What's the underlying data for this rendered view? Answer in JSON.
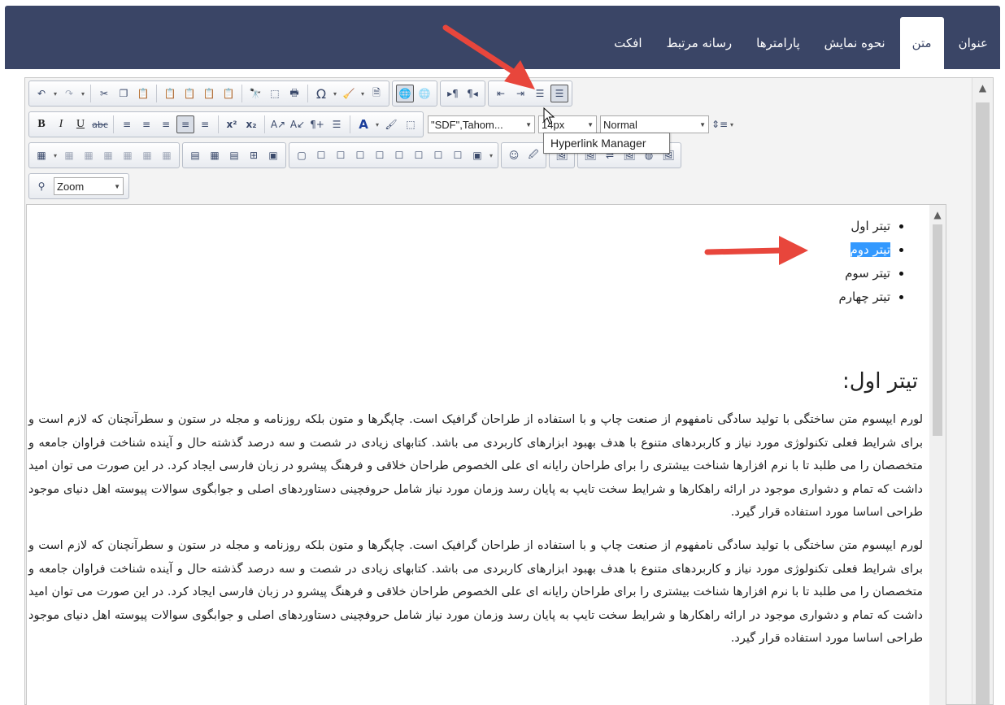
{
  "tabs": [
    {
      "label": "عنوان",
      "active": false
    },
    {
      "label": "متن",
      "active": true
    },
    {
      "label": "نحوه نمایش",
      "active": false
    },
    {
      "label": "پارامترها",
      "active": false
    },
    {
      "label": "رسانه مرتبط",
      "active": false
    },
    {
      "label": "افکت",
      "active": false
    }
  ],
  "toolbar": {
    "font_name": "\"SDF\",Tahom...",
    "font_size": "14px",
    "paragraph_style": "Normal",
    "zoom": "Zoom"
  },
  "tooltip": "Hyperlink Manager",
  "content": {
    "list_items": [
      "تیتر اول",
      "تیتر دوم",
      "تیتر سوم",
      "تیتر چهارم"
    ],
    "selected_item_index": 1,
    "heading": "تیتر اول:",
    "paragraphs": [
      "لورم ایپسوم متن ساختگی با تولید سادگی نامفهوم از صنعت چاپ و با استفاده از طراحان گرافیک است. چاپگرها و متون بلکه روزنامه و مجله در ستون و سطرآنچنان که لازم است و برای شرایط فعلی تکنولوژی مورد نیاز و کاربردهای متنوع با هدف بهبود ابزارهای کاربردی می باشد. کتابهای زیادی در شصت و سه درصد گذشته حال و آینده شناخت فراوان جامعه و متخصصان را می طلبد تا با نرم افزارها شناخت بیشتری را برای طراحان رایانه ای علی الخصوص طراحان خلاقی و فرهنگ پیشرو در زبان فارسی ایجاد کرد. در این صورت می توان امید داشت که تمام و دشواری موجود در ارائه راهکارها و شرایط سخت تایپ به پایان رسد وزمان مورد نیاز شامل حروفچینی دستاوردهای اصلی و جوابگوی سوالات پیوسته اهل دنیای موجود طراحی اساسا مورد استفاده قرار گیرد.",
      "لورم ایپسوم متن ساختگی با تولید سادگی نامفهوم از صنعت چاپ و با استفاده از طراحان گرافیک است. چاپگرها و متون بلکه روزنامه و مجله در ستون و سطرآنچنان که لازم است و برای شرایط فعلی تکنولوژی مورد نیاز و کاربردهای متنوع با هدف بهبود ابزارهای کاربردی می باشد. کتابهای زیادی در شصت و سه درصد گذشته حال و آینده شناخت فراوان جامعه و متخصصان را می طلبد تا با نرم افزارها شناخت بیشتری را برای طراحان رایانه ای علی الخصوص طراحان خلاقی و فرهنگ پیشرو در زبان فارسی ایجاد کرد. در این صورت می توان امید داشت که تمام و دشواری موجود در ارائه راهکارها و شرایط سخت تایپ به پایان رسد وزمان مورد نیاز شامل حروفچینی دستاوردهای اصلی و جوابگوی سوالات پیوسته اهل دنیای موجود طراحی اساسا مورد استفاده قرار گیرد."
    ]
  },
  "colors": {
    "tabbar_bg": "#3a4566",
    "annotation_arrow": "#e8463c",
    "selection": "#3399ff"
  }
}
